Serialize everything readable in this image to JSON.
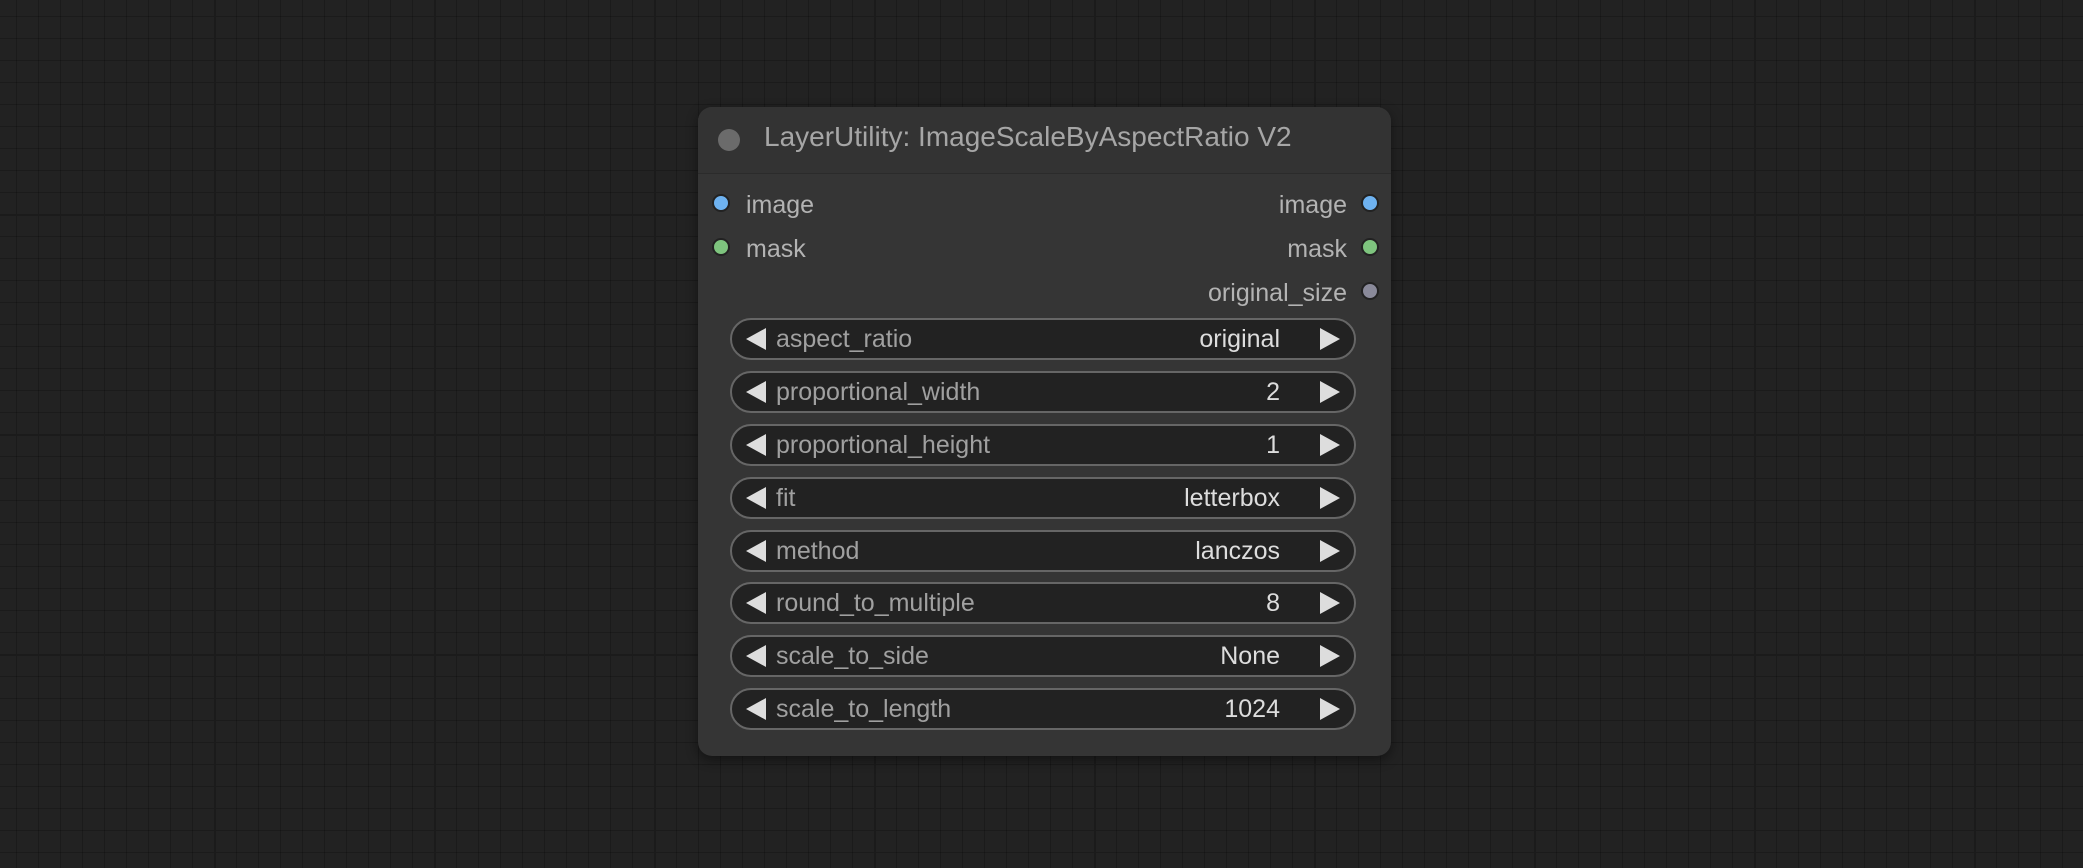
{
  "node": {
    "title": "LayerUtility: ImageScaleByAspectRatio V2",
    "inputs": [
      {
        "label": "image",
        "color": "#6eb2f0"
      },
      {
        "label": "mask",
        "color": "#7ec47e"
      }
    ],
    "outputs": [
      {
        "label": "image",
        "color": "#6eb2f0"
      },
      {
        "label": "mask",
        "color": "#7ec47e"
      },
      {
        "label": "original_size",
        "color": "#8a8a9a"
      }
    ],
    "widgets": [
      {
        "label": "aspect_ratio",
        "value": "original"
      },
      {
        "label": "proportional_width",
        "value": "2"
      },
      {
        "label": "proportional_height",
        "value": "1"
      },
      {
        "label": "fit",
        "value": "letterbox"
      },
      {
        "label": "method",
        "value": "lanczos"
      },
      {
        "label": "round_to_multiple",
        "value": "8"
      },
      {
        "label": "scale_to_side",
        "value": "None"
      },
      {
        "label": "scale_to_length",
        "value": "1024"
      }
    ]
  }
}
